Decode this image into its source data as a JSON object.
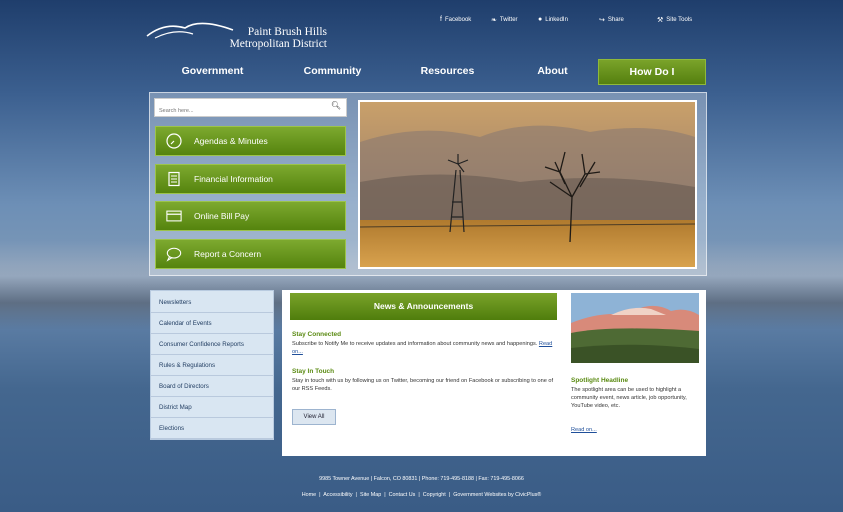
{
  "header": {
    "logo_line1": "Paint Brush Hills",
    "logo_line2": "Metropolitan District",
    "social": [
      {
        "label": "Facebook",
        "icon": "facebook-icon",
        "glyph": "f"
      },
      {
        "label": "Twitter",
        "icon": "twitter-icon",
        "glyph": "❧"
      },
      {
        "label": "LinkedIn",
        "icon": "linkedin-icon",
        "glyph": "●"
      },
      {
        "label": "Share",
        "icon": "share-icon",
        "glyph": "↪"
      },
      {
        "label": "Site Tools",
        "icon": "tools-icon",
        "glyph": "⚒"
      }
    ]
  },
  "nav": {
    "items": [
      "Government",
      "Community",
      "Resources",
      "About",
      "How Do I"
    ]
  },
  "search": {
    "placeholder": "Search here..."
  },
  "quick_links": [
    {
      "label": "Agendas & Minutes",
      "icon": "clock-icon"
    },
    {
      "label": "Financial Information",
      "icon": "document-icon"
    },
    {
      "label": "Online Bill Pay",
      "icon": "credit-card-icon"
    },
    {
      "label": "Report a Concern",
      "icon": "chat-bubble-icon"
    }
  ],
  "sidebar": {
    "items": [
      "Newsletters",
      "Calendar of Events",
      "Consumer Confidence Reports",
      "Rules & Regulations",
      "Board of Directors",
      "District Map",
      "Elections"
    ]
  },
  "news": {
    "heading": "News & Announcements",
    "items": [
      {
        "title": "Stay Connected",
        "body": "Subscribe to Notify Me to receive updates and information about community news and happenings.",
        "link": "Read on..."
      },
      {
        "title": "Stay In Touch",
        "body": "Stay in touch with us by following us on Twitter, becoming our friend on Facebook or subscribing to one of our RSS Feeds.",
        "link": ""
      }
    ],
    "view_all": "View All"
  },
  "spotlight": {
    "title": "Spotlight Headline",
    "body": "The spotlight area can be used to highlight a community event, news article, job opportunity, YouTube video, etc.",
    "link": "Read on..."
  },
  "footer": {
    "address": "9985 Towner Avenue  |  Falcon, CO 80831  |  Phone: 719-495-8188  |  Fax: 719-495-8066",
    "links": [
      "Home",
      "Accessibility",
      "Site Map",
      "Contact Us",
      "Copyright",
      "Government Websites by CivicPlus®"
    ]
  },
  "colors": {
    "accent_green": "#5a8a12",
    "nav_bg": "#1f3e6c",
    "link_blue": "#1f4f9a"
  }
}
